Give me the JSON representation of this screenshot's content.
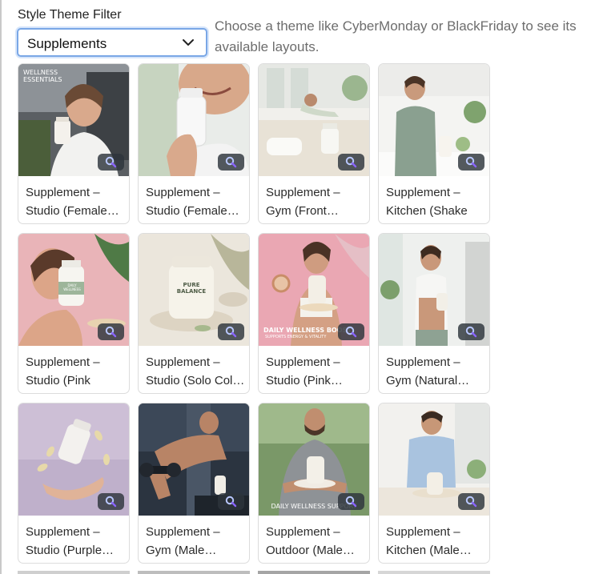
{
  "filter": {
    "label": "Style Theme Filter",
    "selected": "Supplements",
    "help": "Choose a theme like CyberMonday or BlackFriday to see its available layouts."
  },
  "icons": {
    "dropdown": "chevron-down-icon",
    "zoom": "search-zoom-icon"
  },
  "colors": {
    "focus_border": "#7aa7e6",
    "zoom_accent": "#7b5cff",
    "card_border": "#dcdcdc"
  },
  "cards": [
    {
      "title": "Supplement – Studio (Female… Car Selfie…",
      "overlay": "WELLNESS ESSENTIALS",
      "scene": "car"
    },
    {
      "title": "Supplement – Studio (Female… Beach Daily Health",
      "overlay": "",
      "scene": "closeup"
    },
    {
      "title": "Supplement – Gym (Front… Stretch Routine",
      "overlay": "",
      "scene": "yoga"
    },
    {
      "title": "Supplement – Kitchen (Shake S… Healthy…",
      "overlay": "",
      "scene": "kitchen"
    },
    {
      "title": "Supplement – Studio (Pink Smi… Cream Health…",
      "overlay": "DAILY WELLNESS",
      "scene": "pinksmile"
    },
    {
      "title": "Supplement – Studio (Solo Col… Pure Balance…",
      "overlay": "PURE BALANCE",
      "scene": "product"
    },
    {
      "title": "Supplement – Studio (Pink… Donut Snack…",
      "overlay": "DAILY WELLNESS BOOST",
      "overlay2": "SUPPORTS ENERGY & VITALITY",
      "scene": "donut"
    },
    {
      "title": "Supplement – Gym (Natural… Smile Health…",
      "overlay": "",
      "scene": "gymwoman"
    },
    {
      "title": "Supplement – Studio (Purple… Floating Health…",
      "overlay": "",
      "scene": "floating"
    },
    {
      "title": "Supplement – Gym (Male… Dumbbell…",
      "overlay": "",
      "scene": "dumbbell"
    },
    {
      "title": "Supplement – Outdoor (Male… Lunch Health…",
      "overlay": "DAILY WELLNESS SUPPORT",
      "scene": "outdoor"
    },
    {
      "title": "Supplement – Kitchen (Male… Morning Routine…",
      "overlay": "",
      "scene": "kitchenman"
    }
  ]
}
